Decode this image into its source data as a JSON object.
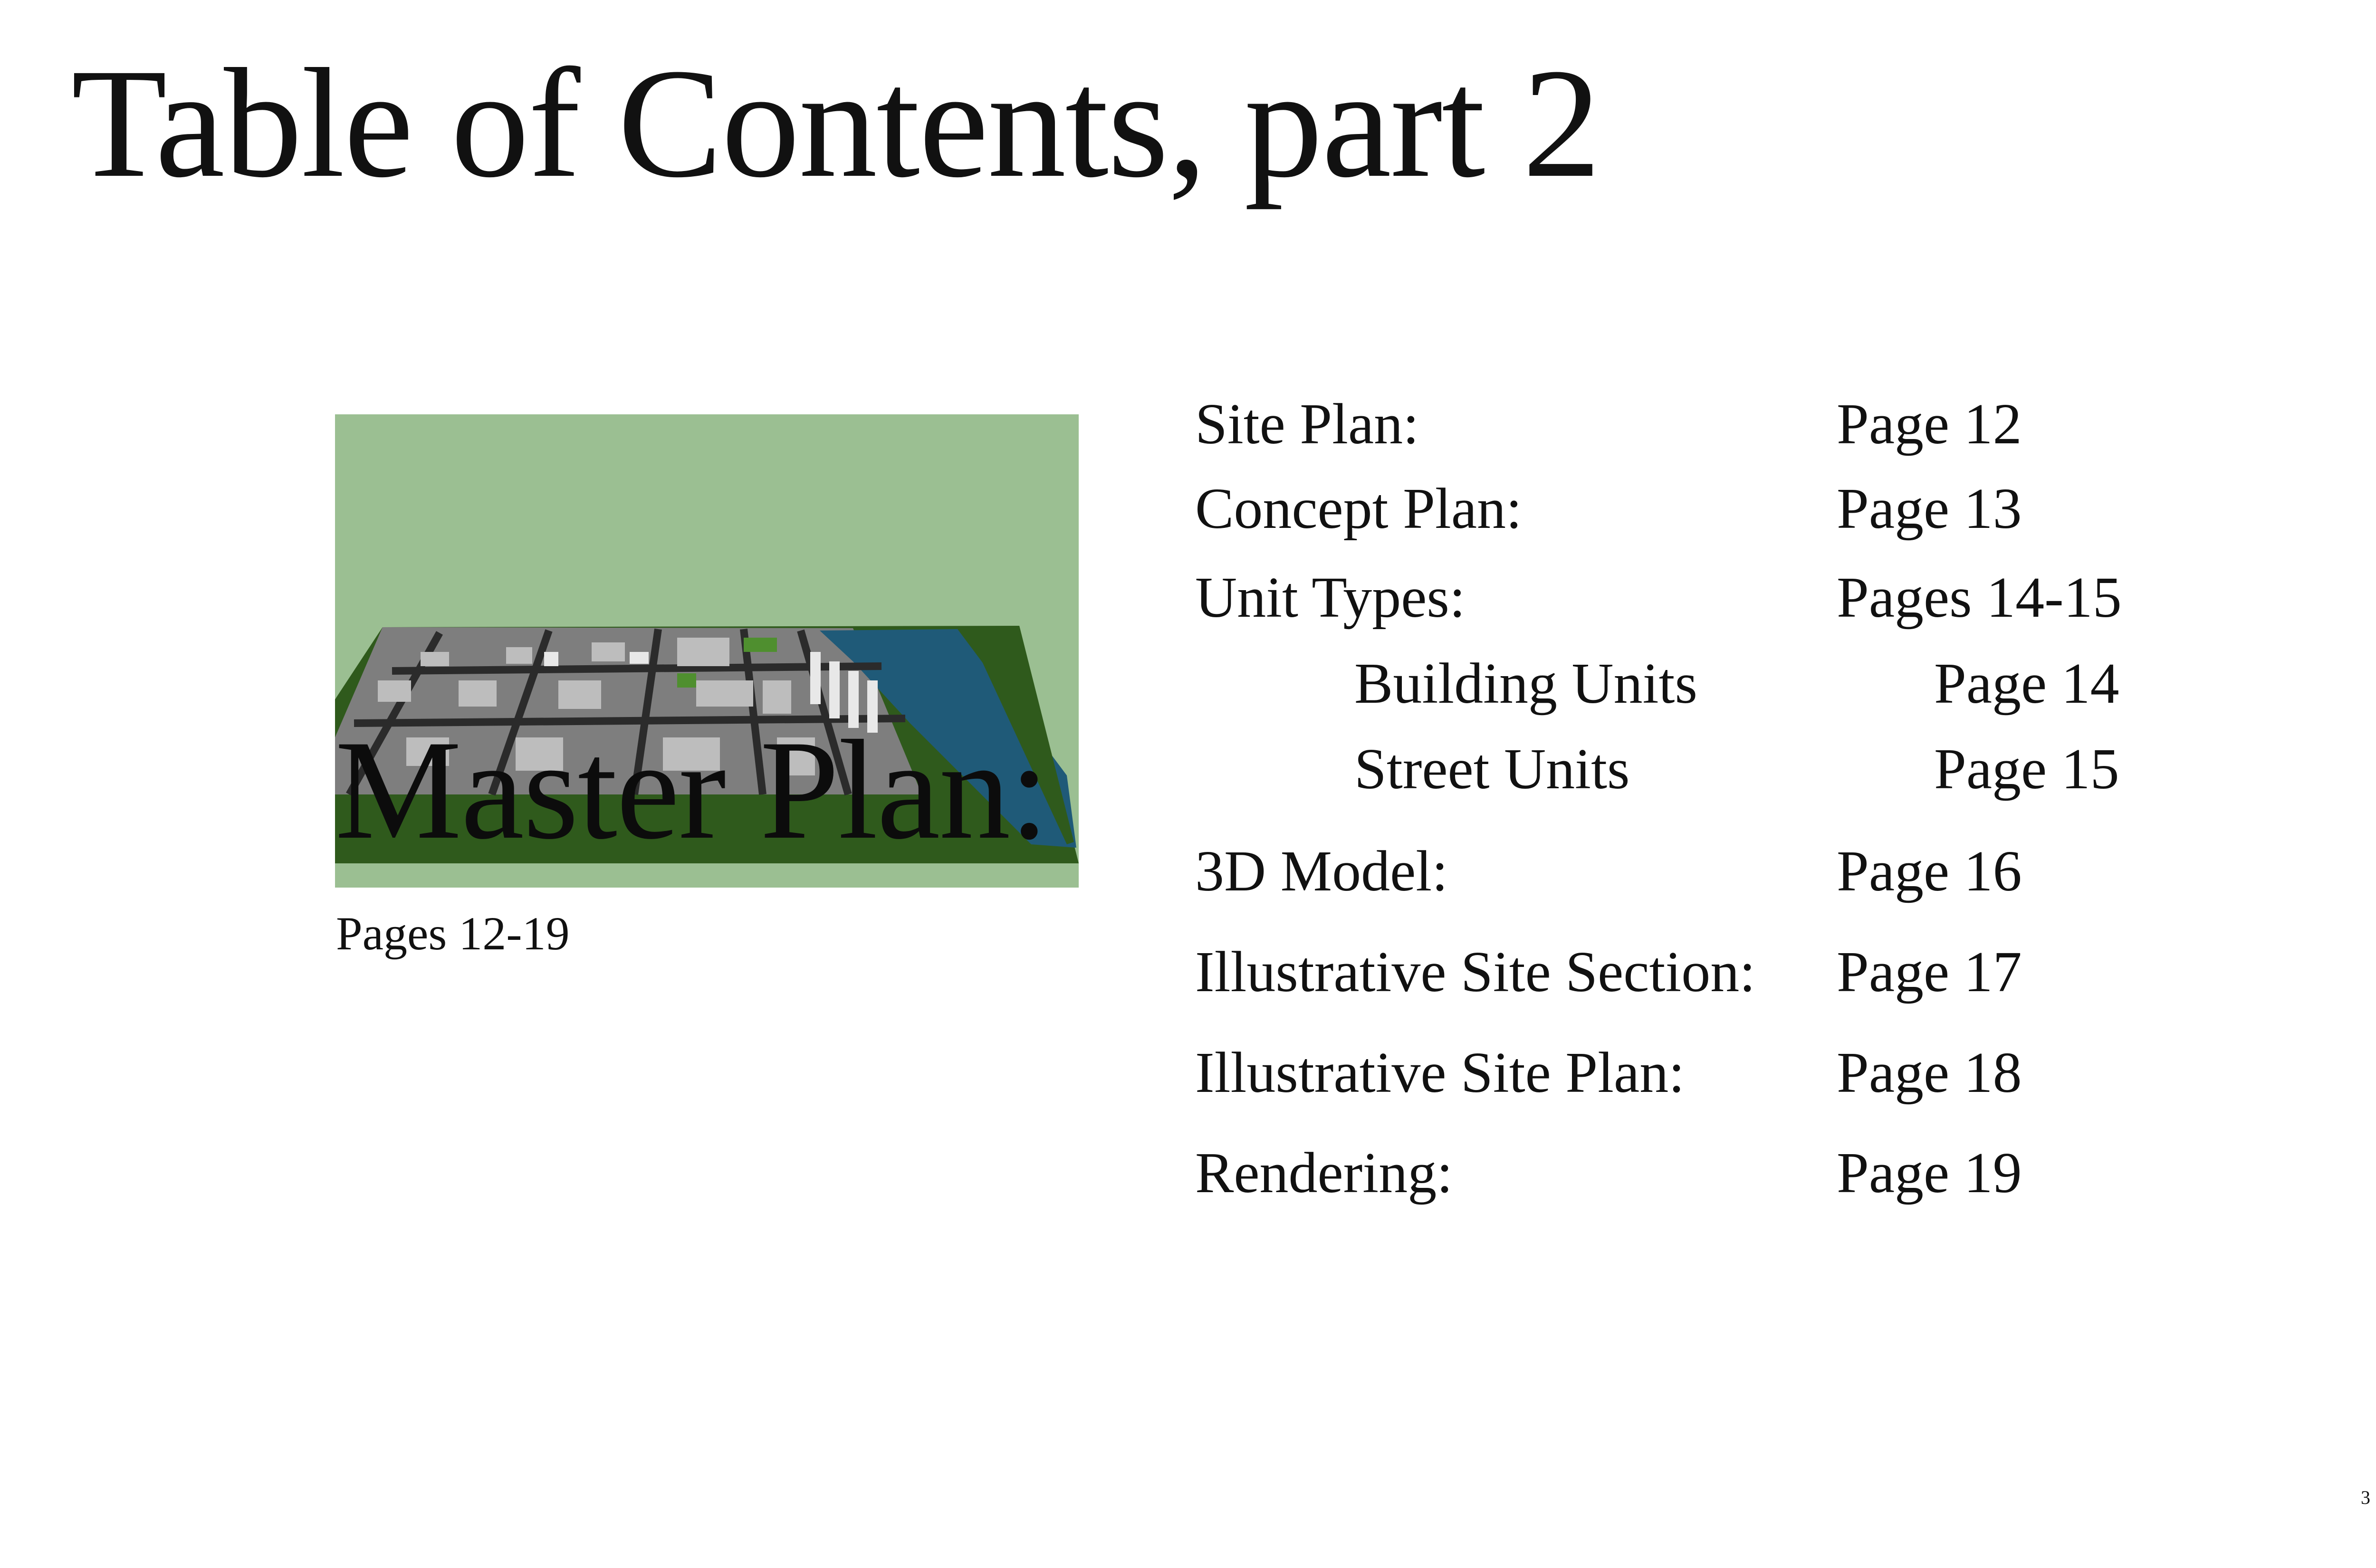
{
  "title": "Table of Contents, part 2",
  "section": {
    "heading": "Master Plan:",
    "pages": "Pages 12-19",
    "image_alt": "3D city model aerial view with river",
    "colors": {
      "background": "#9bbf92",
      "river": "#1f5a78",
      "land": "#2f5a1c"
    }
  },
  "entries": [
    {
      "label": "Site Plan:",
      "page": "Page 12"
    },
    {
      "label": "Concept Plan:",
      "page": "Page 13"
    },
    {
      "label": "Unit Types:",
      "page": "Pages 14-15"
    },
    {
      "label": "Building Units",
      "page": "Page 14",
      "indent": true
    },
    {
      "label": "Street Units",
      "page": "Page 15",
      "indent": true
    },
    {
      "label": "3D Model:",
      "page": "Page 16"
    },
    {
      "label": "Illustrative Site Section:",
      "page": "Page 17"
    },
    {
      "label": "Illustrative Site Plan:",
      "page": "Page 18"
    },
    {
      "label": "Rendering:",
      "page": "Page 19"
    }
  ],
  "page_number": "3"
}
